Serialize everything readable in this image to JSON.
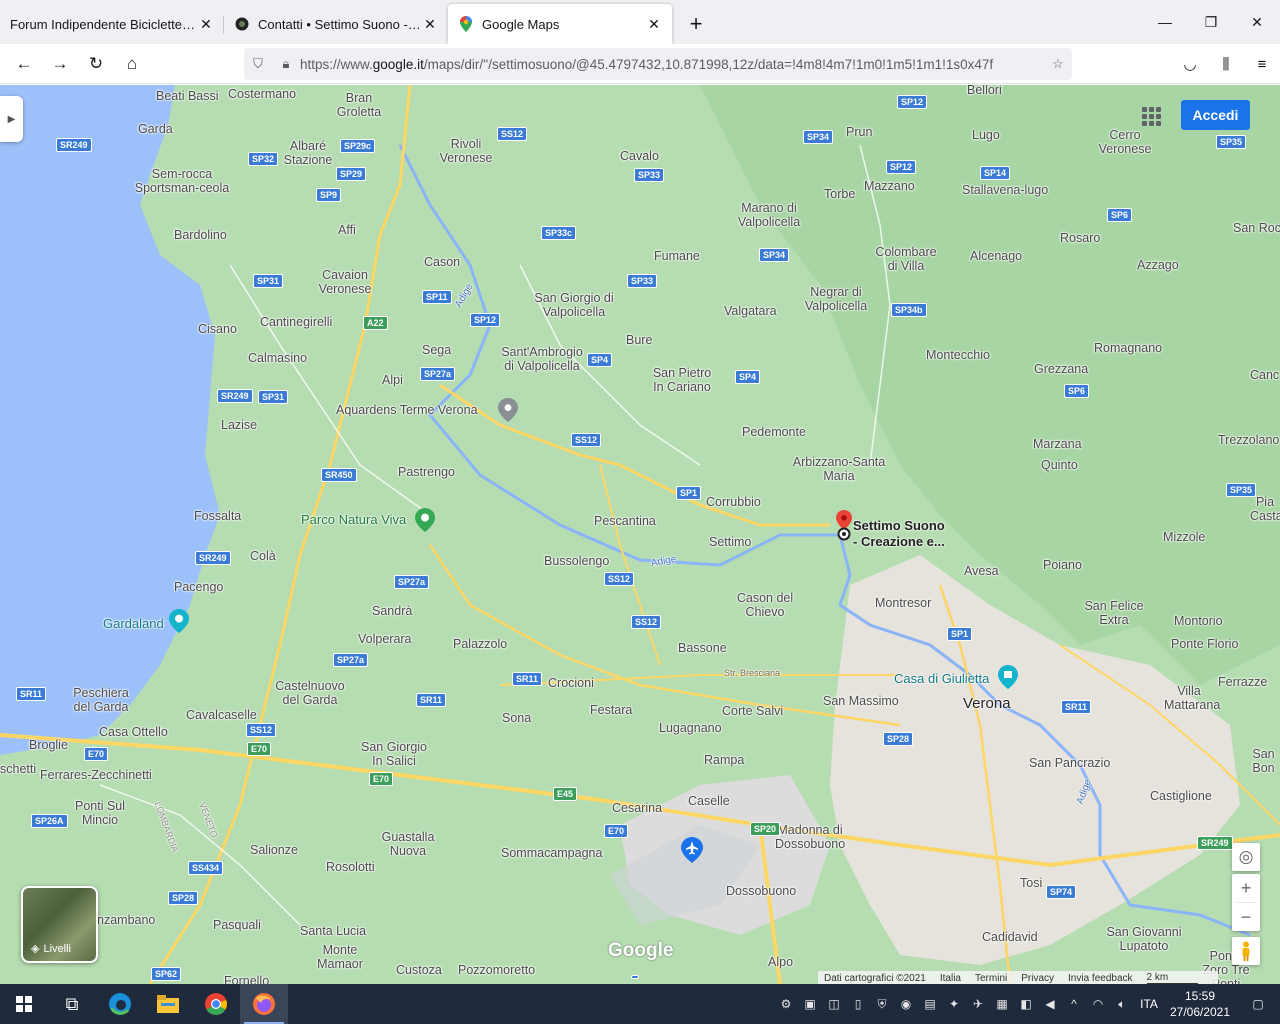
{
  "browser": {
    "tabs": [
      {
        "title": "Forum Indipendente Biciclette Elettriche",
        "favicon": "forum-icon",
        "active": false
      },
      {
        "title": "Contatti • Settimo Suono - Acti",
        "favicon": "settimo-suono-icon",
        "active": false
      },
      {
        "title": "Google Maps",
        "favicon": "google-maps-icon",
        "active": true
      }
    ],
    "url_prefix": "https://www.",
    "url_domain": "google.it",
    "url_rest": "/maps/dir/''/settimosuono/@45.4797432,10.871998,12z/data=!4m8!4m7!1m0!1m5!1m1!1s0x47f"
  },
  "map": {
    "signin_label": "Accedi",
    "layers_label": "Livelli",
    "google_logo": "Google",
    "destination": {
      "line1": "Settimo Suono",
      "line2": "- Creazione e..."
    },
    "places": [
      {
        "name": "Beati Bassi"
      },
      {
        "name": "Costermano"
      },
      {
        "name": "Bran Groletta"
      },
      {
        "name": "Garda"
      },
      {
        "name": "Albaré Stazione"
      },
      {
        "name": "Rivoli Veronese"
      },
      {
        "name": "Cavalo"
      },
      {
        "name": "Prun"
      },
      {
        "name": "Bellori"
      },
      {
        "name": "Lugo"
      },
      {
        "name": "Cerro Veronese"
      },
      {
        "name": "Sem-rocca Sportsman-ceola"
      },
      {
        "name": "Torbe"
      },
      {
        "name": "Mazzano"
      },
      {
        "name": "Stallavena-lugo"
      },
      {
        "name": "Bardolino"
      },
      {
        "name": "Affi"
      },
      {
        "name": "Marano di Valpolicella"
      },
      {
        "name": "San Roc"
      },
      {
        "name": "Cason"
      },
      {
        "name": "Fumane"
      },
      {
        "name": "Colombare di Villa"
      },
      {
        "name": "Alcenago"
      },
      {
        "name": "Rosaro"
      },
      {
        "name": "Azzago"
      },
      {
        "name": "Cavaion Veronese"
      },
      {
        "name": "San Giorgio di Valpolicella"
      },
      {
        "name": "Negrar di Valpolicella"
      },
      {
        "name": "Cisano"
      },
      {
        "name": "Cantinegirelli"
      },
      {
        "name": "Valgatara"
      },
      {
        "name": "Sega"
      },
      {
        "name": "Bure"
      },
      {
        "name": "Sant'Ambrogio di Valpolicella"
      },
      {
        "name": "Calmasino"
      },
      {
        "name": "Montecchio"
      },
      {
        "name": "Romagnano"
      },
      {
        "name": "Alpi"
      },
      {
        "name": "San Pietro In Cariano"
      },
      {
        "name": "Grezzana"
      },
      {
        "name": "Canc"
      },
      {
        "name": "Aquardens Terme Verona"
      },
      {
        "name": "Lazise"
      },
      {
        "name": "Pedemonte"
      },
      {
        "name": "Trezzolano"
      },
      {
        "name": "Marzana"
      },
      {
        "name": "Quinto"
      },
      {
        "name": "Pastrengo"
      },
      {
        "name": "Arbizzano-Santa Maria"
      },
      {
        "name": "Fossalta"
      },
      {
        "name": "Corrubbio"
      },
      {
        "name": "Pia Casta"
      },
      {
        "name": "Parco Natura Viva"
      },
      {
        "name": "Pescantina"
      },
      {
        "name": "Settimo"
      },
      {
        "name": "Mizzole"
      },
      {
        "name": "Colà"
      },
      {
        "name": "Bussolengo"
      },
      {
        "name": "Avesa"
      },
      {
        "name": "Poiano"
      },
      {
        "name": "Pacengo"
      },
      {
        "name": "Cason del Chievo"
      },
      {
        "name": "Montresor"
      },
      {
        "name": "San Felice Extra"
      },
      {
        "name": "Montorio"
      },
      {
        "name": "Sandrà"
      },
      {
        "name": "Gardaland"
      },
      {
        "name": "Ponte Florio"
      },
      {
        "name": "Volperara"
      },
      {
        "name": "Palazzolo"
      },
      {
        "name": "Bassone"
      },
      {
        "name": "Casa di Giulietta"
      },
      {
        "name": "Ferrazze"
      },
      {
        "name": "Peschiera del Garda"
      },
      {
        "name": "Castelnuovo del Garda"
      },
      {
        "name": "Crocioni"
      },
      {
        "name": "Verona"
      },
      {
        "name": "Villa Mattarana"
      },
      {
        "name": "Cavalcaselle"
      },
      {
        "name": "Festara"
      },
      {
        "name": "Corte Salvi"
      },
      {
        "name": "San Massimo"
      },
      {
        "name": "Sona"
      },
      {
        "name": "Casa Ottello"
      },
      {
        "name": "Lugagnano"
      },
      {
        "name": "Broglie"
      },
      {
        "name": "San Giorgio In Salici"
      },
      {
        "name": "San Pancrazio"
      },
      {
        "name": "San Bon"
      },
      {
        "name": "schetti"
      },
      {
        "name": "Ferrares-Zecchinetti"
      },
      {
        "name": "Rampa"
      },
      {
        "name": "Castiglione"
      },
      {
        "name": "Ponti Sul Mincio"
      },
      {
        "name": "Cesarina"
      },
      {
        "name": "Caselle"
      },
      {
        "name": "Guastalla Nuova"
      },
      {
        "name": "Madonna di Dossobuono"
      },
      {
        "name": "Salionze"
      },
      {
        "name": "Sommacampagna"
      },
      {
        "name": "Rosolotti"
      },
      {
        "name": "Tosi"
      },
      {
        "name": "Dossobuono"
      },
      {
        "name": "nzambano"
      },
      {
        "name": "Pasquali"
      },
      {
        "name": "Santa Lucia"
      },
      {
        "name": "Cadidavid"
      },
      {
        "name": "San Giovanni Lupatoto"
      },
      {
        "name": "Monte Mamaor"
      },
      {
        "name": "Ponto Zoro Tre Ponti"
      },
      {
        "name": "Fornello"
      },
      {
        "name": "Custoza"
      },
      {
        "name": "Pozzomoretto"
      },
      {
        "name": "Alpo"
      }
    ],
    "water_labels": {
      "adige1": "Adige",
      "adige2": "Adige",
      "adige3": "Adige",
      "region1": "VENETO",
      "region2": "LOMBARDIA"
    },
    "roads": [
      "SR249",
      "SP29c",
      "SS12",
      "SP12",
      "SP34",
      "SP35",
      "SP32",
      "SP29",
      "SP9",
      "SP33",
      "SP12",
      "SP14",
      "SP6",
      "SP33c",
      "SP34",
      "SP31",
      "SP11",
      "SP33",
      "A22",
      "SP34b",
      "SP12",
      "SP27a",
      "SP4",
      "SP4",
      "SR249",
      "SP31",
      "SP6",
      "SS12",
      "SR450",
      "SP1",
      "SP35",
      "SR249",
      "SS12",
      "SP27a",
      "SS12",
      "SP1",
      "SP27a",
      "SR11",
      "SR11",
      "Str. Bresciana",
      "SR11",
      "SR11",
      "SS12",
      "SP28",
      "E70",
      "E70",
      "E70",
      "E45",
      "SP20",
      "SP26A",
      "E70",
      "SR249",
      "SS434",
      "SP74",
      "SP28",
      "SP62"
    ],
    "attribution": {
      "data": "Dati cartografici ©2021",
      "country": "Italia",
      "terms": "Termini",
      "privacy": "Privacy",
      "feedback": "Invia feedback",
      "scale": "2 km"
    }
  },
  "taskbar": {
    "language": "ITA",
    "time": "15:59",
    "date": "27/06/2021"
  }
}
